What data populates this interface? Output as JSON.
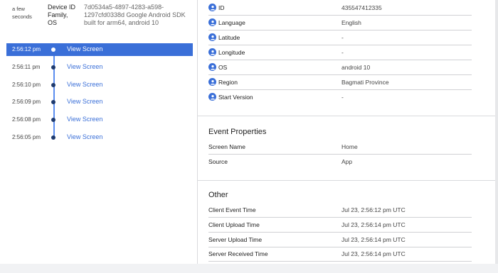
{
  "left": {
    "time_ago": "a few seconds",
    "device_label": "Device ID Family, OS",
    "device_value": "7d0534a5-4897-4283-a598-1297cfd0338d Google Android SDK built for arm64, android 10",
    "timeline": [
      {
        "time": "2:56:12 pm",
        "label": "View Screen",
        "selected": true
      },
      {
        "time": "2:56:11 pm",
        "label": "View Screen",
        "selected": false
      },
      {
        "time": "2:56:10 pm",
        "label": "View Screen",
        "selected": false
      },
      {
        "time": "2:56:09 pm",
        "label": "View Screen",
        "selected": false
      },
      {
        "time": "2:56:08 pm",
        "label": "View Screen",
        "selected": false
      },
      {
        "time": "2:56:05 pm",
        "label": "View Screen",
        "selected": false
      }
    ]
  },
  "right": {
    "user_properties": [
      {
        "label": "ID",
        "value": "435547412335"
      },
      {
        "label": "Language",
        "value": "English"
      },
      {
        "label": "Latitude",
        "value": "-"
      },
      {
        "label": "Longitude",
        "value": "-"
      },
      {
        "label": "OS",
        "value": "android 10"
      },
      {
        "label": "Region",
        "value": "Bagmati Province"
      },
      {
        "label": "Start Version",
        "value": "-"
      }
    ],
    "event_properties": {
      "title": "Event Properties",
      "rows": [
        {
          "label": "Screen Name",
          "value": "Home"
        },
        {
          "label": "Source",
          "value": "App"
        }
      ]
    },
    "other": {
      "title": "Other",
      "rows": [
        {
          "label": "Client Event Time",
          "value": "Jul 23, 2:56:12 pm UTC"
        },
        {
          "label": "Client Upload Time",
          "value": "Jul 23, 2:56:14 pm UTC"
        },
        {
          "label": "Server Upload Time",
          "value": "Jul 23, 2:56:14 pm UTC"
        },
        {
          "label": "Server Received Time",
          "value": "Jul 23, 2:56:14 pm UTC"
        }
      ]
    }
  },
  "colors": {
    "accent": "#3a6fd8",
    "timeline_dot": "#1e3a6e"
  }
}
